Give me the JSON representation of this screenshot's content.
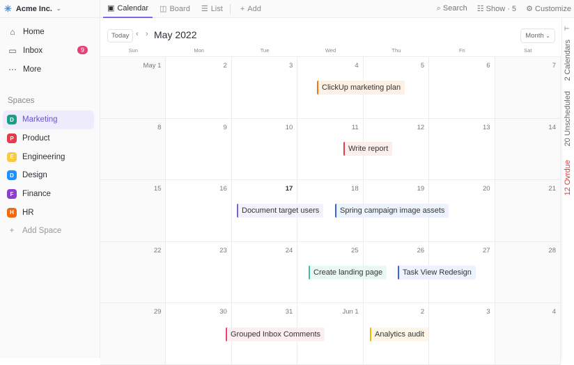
{
  "workspace": {
    "name": "Acme Inc.",
    "logo_icon": "clickup-logo-icon"
  },
  "nav": [
    {
      "label": "Home",
      "icon": "home-icon"
    },
    {
      "label": "Inbox",
      "icon": "inbox-icon",
      "badge": "9"
    },
    {
      "label": "More",
      "icon": "more-icon"
    }
  ],
  "spaces_title": "Spaces",
  "spaces": [
    {
      "initial": "D",
      "label": "Marketing",
      "color": "#1f9d84",
      "active": true
    },
    {
      "initial": "P",
      "label": "Product",
      "color": "#e03e4f"
    },
    {
      "initial": "E",
      "label": "Engineering",
      "color": "#fbc93d"
    },
    {
      "initial": "D",
      "label": "Design",
      "color": "#1e90ff"
    },
    {
      "initial": "F",
      "label": "Finance",
      "color": "#8a3fd1"
    },
    {
      "initial": "H",
      "label": "HR",
      "color": "#f2680c"
    }
  ],
  "add_space": "Add Space",
  "tabs": [
    {
      "label": "Calendar",
      "icon": "calendar-icon",
      "active": true
    },
    {
      "label": "Board",
      "icon": "board-icon"
    },
    {
      "label": "List",
      "icon": "list-icon"
    },
    {
      "label": "Add",
      "icon": "plus-icon"
    }
  ],
  "toolbar": {
    "search": "Search",
    "show": "Show · 5",
    "customize": "Customize"
  },
  "calendar": {
    "today": "Today",
    "title": "May 2022",
    "view": "Month",
    "weekdays": [
      "Sun",
      "Mon",
      "Tue",
      "Wed",
      "Thu",
      "Fri",
      "Sat"
    ],
    "days": [
      "May 1",
      "2",
      "3",
      "4",
      "5",
      "6",
      "7",
      "8",
      "9",
      "10",
      "11",
      "12",
      "13",
      "14",
      "15",
      "16",
      "17",
      "18",
      "19",
      "20",
      "21",
      "22",
      "23",
      "24",
      "25",
      "26",
      "27",
      "28",
      "29",
      "30",
      "31",
      "Jun 1",
      "2",
      "3",
      "4"
    ],
    "today_index": 16,
    "events": [
      {
        "title": "ClickUp marketing plan",
        "color": "#f97316",
        "bg": "#fdf0e4"
      },
      {
        "title": "Write report",
        "color": "#e03e4f",
        "bg": "#fdeeee"
      },
      {
        "title": "Document target users",
        "color": "#7b61d1",
        "bg": "#f3f1fd"
      },
      {
        "title": "Spring campaign image assets",
        "color": "#3b63d6",
        "bg": "#edf3fe"
      },
      {
        "title": "Create landing page",
        "color": "#3fbfa0",
        "bg": "#eaf8f3"
      },
      {
        "title": "Task View Redesign",
        "color": "#3b63d6",
        "bg": "#edf3fe"
      },
      {
        "title": "Grouped Inbox Comments",
        "color": "#e8417a",
        "bg": "#fdeef0"
      },
      {
        "title": "Analytics audit",
        "color": "#f5b400",
        "bg": "#fef7e8"
      }
    ]
  },
  "right_panel": {
    "calendars": "2 Calendars",
    "unscheduled": "20 Unscheduled",
    "overdue": "12 Ovrdue",
    "overdue_color": "#d93a3a"
  }
}
